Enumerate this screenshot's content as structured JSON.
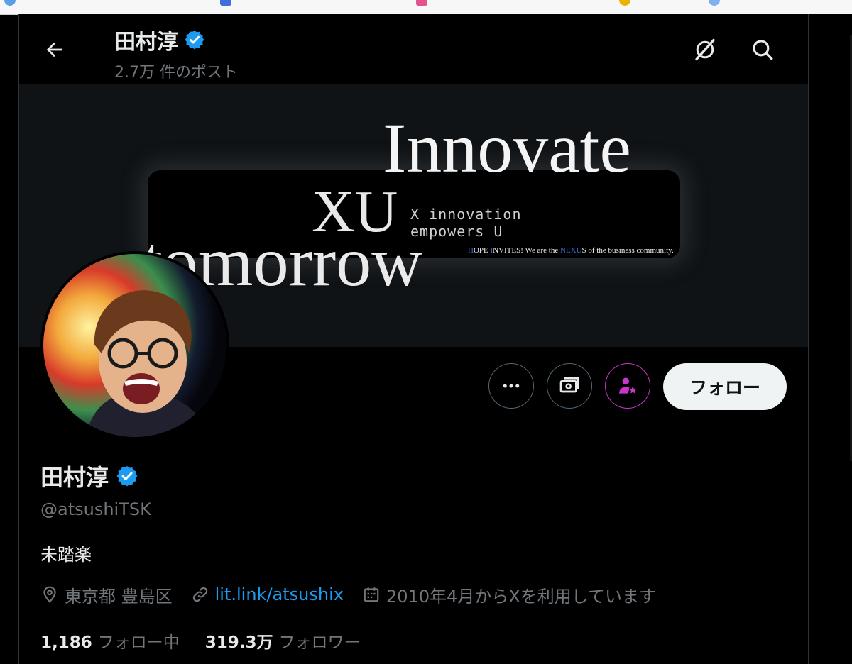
{
  "browser": {
    "colors": [
      "#5aa0e6",
      "#3f6fd8",
      "#e5508e",
      "#e8b400",
      "#7fb0f0"
    ]
  },
  "header": {
    "display_name": "田村淳",
    "post_count": "2.7万 件のポスト",
    "icons": [
      "back-arrow-icon",
      "grok-icon",
      "search-icon"
    ]
  },
  "banner": {
    "word_top": "Innovate",
    "word_bottom": "tomorrow",
    "logo": "XU",
    "logo_line1": "X innovation",
    "logo_line2": "empowers U",
    "tagline_parts": [
      "H",
      "OPE ",
      "I",
      "NVITES! We are the ",
      "NEXU",
      "S of the business community."
    ]
  },
  "actions": {
    "more_icon": "more-dots-icon",
    "tip_icon": "money-icon",
    "subscribe_icon": "subscribe-star-person-icon",
    "follow_label": "フォロー"
  },
  "profile": {
    "display_name": "田村淳",
    "handle": "@atsushiTSK",
    "bio": "未踏楽",
    "location": "東京都 豊島区",
    "link": "lit.link/atsushix",
    "joined": "2010年4月からXを利用しています",
    "following_count": "1,186",
    "following_label": "フォロー中",
    "followers_count": "319.3万",
    "followers_label": "フォロワー"
  },
  "colors": {
    "verified_blue": "#1d9bf0",
    "link_blue": "#1d9bf0",
    "subscribe_purple": "#c936cc",
    "muted_gray": "#71767b"
  }
}
